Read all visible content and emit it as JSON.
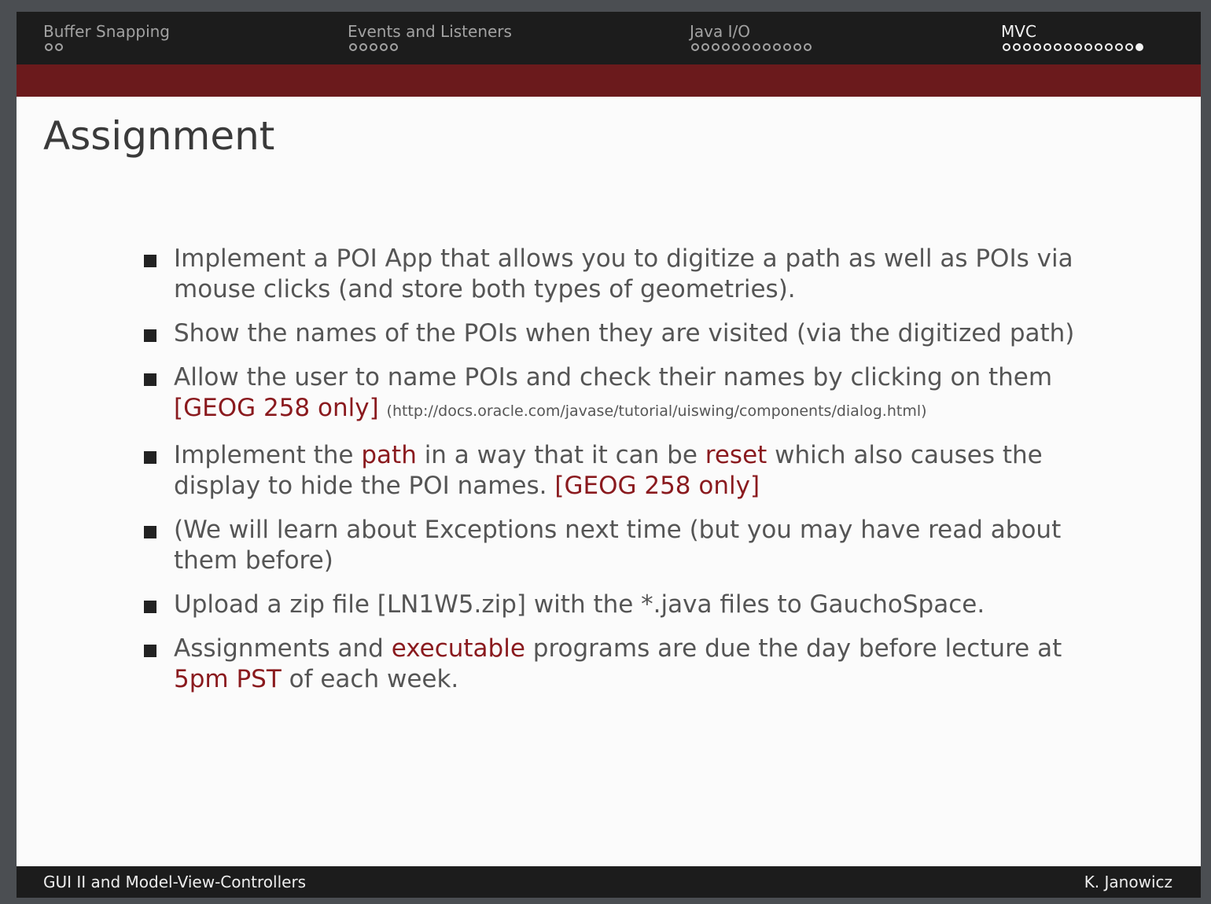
{
  "nav": {
    "sections": [
      {
        "label": "Buffer Snapping",
        "dots": 2,
        "filled": []
      },
      {
        "label": "Events and Listeners",
        "dots": 5,
        "filled": []
      },
      {
        "label": "Java I/O",
        "dots": 12,
        "filled": []
      },
      {
        "label": "MVC",
        "dots": 14,
        "filled": [
          13
        ]
      }
    ],
    "current_section": "MVC",
    "colors": {
      "bar": "#1c1c1c",
      "accent_bar": "#6b1a1c",
      "current": "#f2f2f2",
      "inactive": "#a2a2a2"
    }
  },
  "frame": {
    "title": "Assignment",
    "items": [
      [
        {
          "t": "Implement a POI App that allows you to digitize a path as well as POIs via mouse clicks (and store both types of geometries)."
        }
      ],
      [
        {
          "t": "Show the names of the POIs when they are visited (via the digitized path)"
        }
      ],
      [
        {
          "t": "Allow the user to name POIs and check their names by clicking on them "
        },
        {
          "t": "[GEOG 258 only]",
          "hl": true
        },
        {
          "t": " "
        },
        {
          "t": "(http://docs.oracle.com/javase/tutorial/uiswing/components/dialog.html)",
          "url": true
        }
      ],
      [
        {
          "t": "Implement the "
        },
        {
          "t": "path",
          "hl": true
        },
        {
          "t": " in a way that it can be "
        },
        {
          "t": "reset",
          "hl": true
        },
        {
          "t": " which also causes the display to hide the POI names. "
        },
        {
          "t": "[GEOG 258 only]",
          "hl": true
        }
      ],
      [
        {
          "t": "(We will learn about Exceptions next time (but you may have read about them before)"
        }
      ],
      [
        {
          "t": "Upload a zip file [LN1W5.zip] with the *.java files to GauchoSpace."
        }
      ],
      [
        {
          "t": "Assignments and "
        },
        {
          "t": "executable",
          "hl": true
        },
        {
          "t": " programs are due the day before lecture at "
        },
        {
          "t": "5pm PST",
          "hl": true
        },
        {
          "t": " of each week."
        }
      ]
    ],
    "highlight_color": "#8a1a1e"
  },
  "footer": {
    "left": "GUI II and Model-View-Controllers",
    "right": "K. Janowicz"
  }
}
